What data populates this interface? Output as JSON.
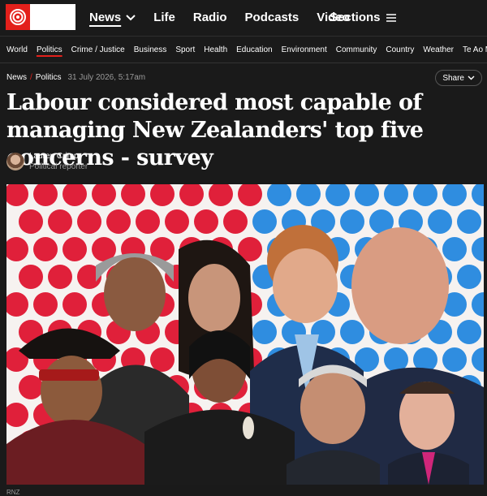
{
  "header": {
    "nav": [
      "News",
      "Life",
      "Radio",
      "Podcasts",
      "Video"
    ],
    "sections_label": "Sections"
  },
  "subnav": [
    "World",
    "Politics",
    "Crime / Justice",
    "Business",
    "Sport",
    "Health",
    "Education",
    "Environment",
    "Community",
    "Country",
    "Weather",
    "Te Ao Māori"
  ],
  "breadcrumb": {
    "section": "News",
    "subsection": "Politics",
    "date": "31 July 2026, 5:17am"
  },
  "share_label": "Share",
  "article": {
    "headline": "Labour considered most capable of managing New Zealanders' top five concerns - survey",
    "author": "Lauren Crimp",
    "author_role": "Political reporter",
    "image_credit": "RNZ"
  },
  "colors": {
    "brand_red": "#e3201b",
    "background": "#1a1a1a",
    "dot_red": "#e0203a",
    "dot_blue": "#2f8de0"
  }
}
